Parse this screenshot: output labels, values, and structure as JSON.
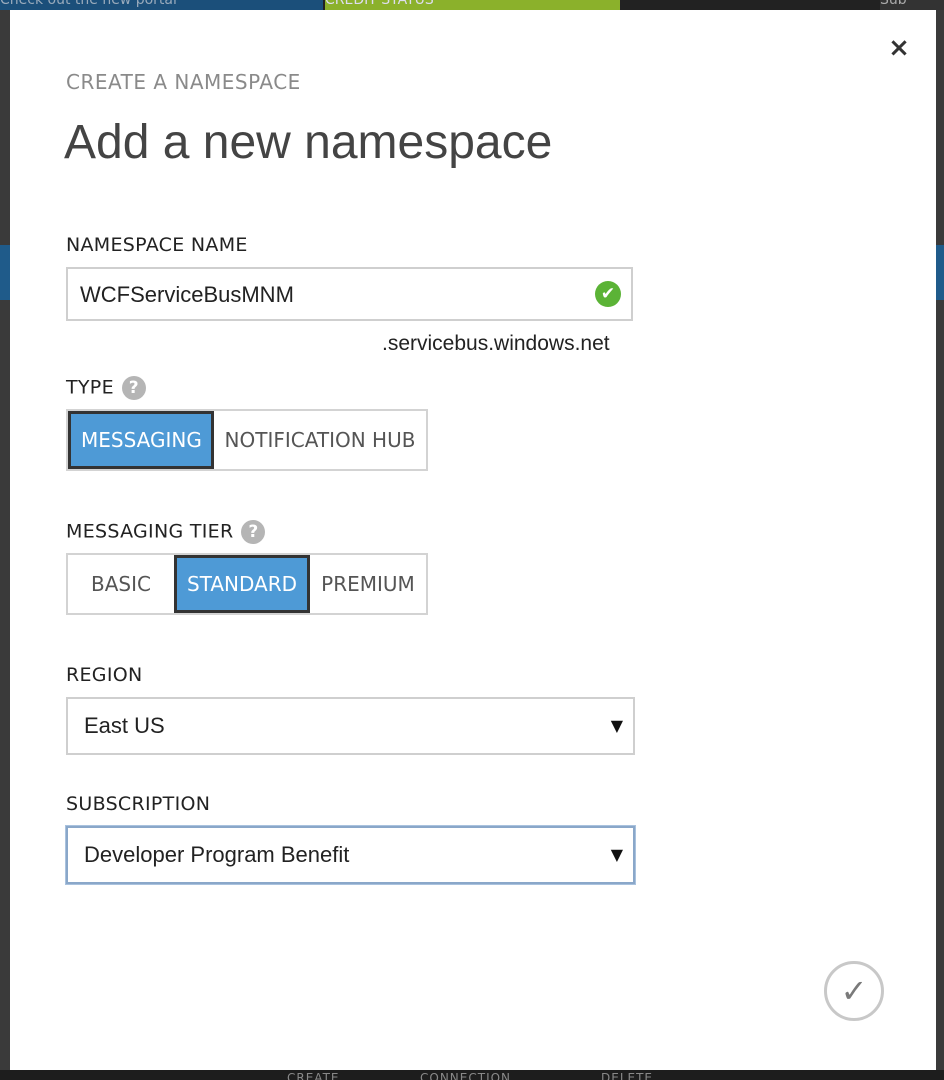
{
  "background": {
    "top_left_text": "Check out the new portal",
    "top_mid_text": "CREDIT STATUS",
    "top_right_text": "Sub",
    "bottom_labels": [
      "CREATE",
      "CONNECTION",
      "DELETE"
    ]
  },
  "dialog": {
    "kicker": "CREATE A NAMESPACE",
    "title": "Add a new namespace",
    "close_glyph": "×",
    "namespace": {
      "label": "NAMESPACE NAME",
      "value": "WCFServiceBusMNM",
      "suffix": ".servicebus.windows.net",
      "valid_glyph": "✔"
    },
    "type": {
      "label": "TYPE",
      "help_glyph": "?",
      "options": [
        "MESSAGING",
        "NOTIFICATION HUB"
      ],
      "selected": "MESSAGING"
    },
    "tier": {
      "label": "MESSAGING TIER",
      "help_glyph": "?",
      "options": [
        "BASIC",
        "STANDARD",
        "PREMIUM"
      ],
      "selected": "STANDARD"
    },
    "region": {
      "label": "REGION",
      "value": "East US",
      "arrow_glyph": "▼"
    },
    "subscription": {
      "label": "SUBSCRIPTION",
      "value": "Developer Program Benefit",
      "arrow_glyph": "▼"
    },
    "ok_glyph": "✓"
  },
  "colors": {
    "accent": "#4e9ad6",
    "valid": "#5bb336"
  }
}
